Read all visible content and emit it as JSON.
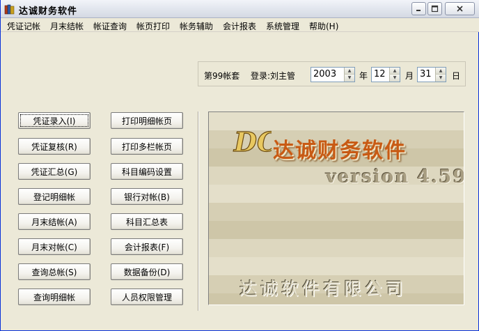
{
  "window": {
    "title": "达诚财务软件"
  },
  "menu": [
    {
      "label": "凭证记帐"
    },
    {
      "label": "月末结帐"
    },
    {
      "label": "帐证查询"
    },
    {
      "label": "帐页打印"
    },
    {
      "label": "帐务辅助"
    },
    {
      "label": "会计报表"
    },
    {
      "label": "系统管理"
    },
    {
      "label": "帮助(H)"
    }
  ],
  "info": {
    "account_set": "第99帐套",
    "login": "登录:刘主管",
    "year": "2003",
    "year_unit": "年",
    "month": "12",
    "month_unit": "月",
    "day": "31",
    "day_unit": "日"
  },
  "left_buttons": [
    {
      "label": "凭证录入(I)"
    },
    {
      "label": "凭证复核(R)"
    },
    {
      "label": "凭证汇总(G)"
    },
    {
      "label": "登记明细帐"
    },
    {
      "label": "月末结帐(A)"
    },
    {
      "label": "月末对帐(C)"
    },
    {
      "label": "查询总帐(S)"
    },
    {
      "label": "查询明细帐"
    }
  ],
  "right_buttons": [
    {
      "label": "打印明细帐页"
    },
    {
      "label": "打印多栏帐页"
    },
    {
      "label": "科目编码设置"
    },
    {
      "label": "银行对帐(B)"
    },
    {
      "label": "科目汇总表"
    },
    {
      "label": "会计报表(F)"
    },
    {
      "label": "数据备份(D)"
    },
    {
      "label": "人员权限管理"
    }
  ],
  "splash": {
    "logo_text": "DC",
    "brand": "达诚财务软件",
    "version": "version 4.59",
    "company": "达诚软件有限公司"
  },
  "colors": {
    "window_bg": "#ece9d8",
    "brand": "#c85a14",
    "splash_bg": "#ddd7bf"
  },
  "icons": {
    "app": "books-icon",
    "minimize": "minimize-icon",
    "maximize": "maximize-icon",
    "close": "close-icon"
  }
}
